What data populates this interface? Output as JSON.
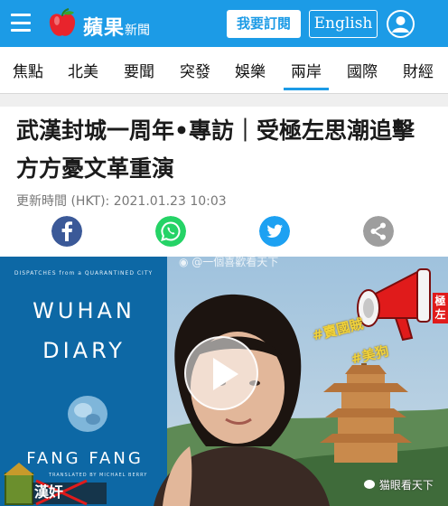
{
  "header": {
    "brand": "蘋果",
    "brand_suffix": "新聞",
    "subscribe_label": "我要訂閱",
    "language_label": "English",
    "logo_icon": "apple-icon",
    "menu_icon": "hamburger-menu-icon",
    "profile_icon": "user-profile-icon"
  },
  "nav": {
    "items": [
      "焦點",
      "北美",
      "要聞",
      "突發",
      "娛樂",
      "兩岸",
      "國際",
      "財經"
    ],
    "active": "兩岸"
  },
  "article": {
    "headline": "武漢封城一周年•專訪｜受極左思潮追擊 方方憂文革重演",
    "timestamp": "更新時間 (HKT): 2021.01.23 10:03",
    "share_icons": [
      "facebook-icon",
      "whatsapp-icon",
      "twitter-icon",
      "share-icon"
    ]
  },
  "image": {
    "book_tagline": "DISPATCHES from a QUARANTINED CITY",
    "book_title": "WUHAN DIARY",
    "book_author": "FANG FANG",
    "book_credit": "TRANSLATED BY MICHAEL BERRY",
    "stamp_text": "漢奸",
    "stamp_caption": "賣國賊",
    "sticker_1": "#賣國賊",
    "sticker_2": "#美狗",
    "side_label": "極左",
    "watermark_top": "@一個喜歡看天下",
    "watermark_bottom": "猫眼看天下"
  },
  "colors": {
    "brand_blue": "#1c9be6",
    "facebook": "#3b5998",
    "whatsapp": "#25d366",
    "twitter": "#1da1f2",
    "share_grey": "#9e9e9e"
  }
}
